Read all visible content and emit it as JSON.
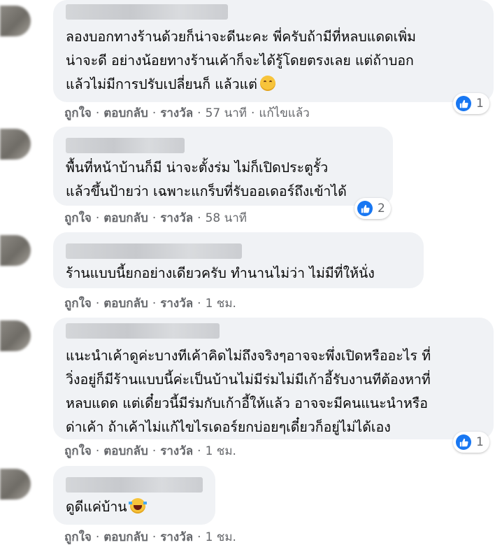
{
  "comments": [
    {
      "lines": [
        "ลองบอกทางร้านด้วยก็น่าจะดีนะคะ พี่ครับถ้ามีที่หลบแดดเพิ่ม",
        "น่าจะดี อย่างน้อยทางร้านเค้าก็จะได้รู้โดยตรงเลย แต่ถ้าบอก",
        "แล้วไม่มีการปรับเปลี่ยนก็ แล้วแต่"
      ],
      "emoji": "smiling-face",
      "like": "ถูกใจ",
      "reply": "ตอบกลับ",
      "award": "รางวัล",
      "time": "57 นาที",
      "edited": "แก้ไขแล้ว",
      "reaction_count": "1"
    },
    {
      "lines": [
        "พื้นที่หน้าบ้านก็มี น่าจะตั้งร่ม ไม่ก็เปิดประตูรั้ว",
        "แล้วขึ้นป้ายว่า เฉพาะแกร็บที่รับออเดอร์ถึงเข้าได้"
      ],
      "like": "ถูกใจ",
      "reply": "ตอบกลับ",
      "award": "รางวัล",
      "time": "58 นาที",
      "reaction_count": "2"
    },
    {
      "lines": [
        "ร้านแบบนี้ยกอย่างเดียวครับ ทำนานไม่ว่า ไม่มีที่ให้นั่ง"
      ],
      "like": "ถูกใจ",
      "reply": "ตอบกลับ",
      "award": "รางวัล",
      "time": "1 ชม."
    },
    {
      "lines": [
        "แนะนำเค้าดูค่ะบางทีเค้าคิดไม่ถึงจริงๆอาจจะพึ่งเปิดหรืออะไร ที่",
        "วิ่งอยู่ก็มีร้านแบบนี้ค่ะเป็นบ้านไม่มีร่มไม่มีเก้าอี้รับงานทีต้องหาที่",
        "หลบแดด แต่เดี๋ยวนี้มีร่มกับเก้าอี้ให้แล้ว อาจจะมีคนแนะนำหรือ",
        "ด่าเค้า ถ้าเค้าไม่แก้ไขไรเดอร์ยกบ่อยๆเดี๋ยวก็อยู่ไม่ได้เอง"
      ],
      "like": "ถูกใจ",
      "reply": "ตอบกลับ",
      "award": "รางวัล",
      "time": "1 ชม.",
      "reaction_count": "1"
    },
    {
      "lines": [
        "ดูดีแค่บ้าน"
      ],
      "emoji": "rolling-on-floor-laughing",
      "like": "ถูกใจ",
      "reply": "ตอบกลับ",
      "award": "รางวัล",
      "time": "1 ชม."
    }
  ],
  "icons": {
    "like": "thumbs-up-icon",
    "like_color": "#1877f2"
  },
  "colors": {
    "bubble": "#f0f2f5",
    "meta_text": "#65676b"
  }
}
